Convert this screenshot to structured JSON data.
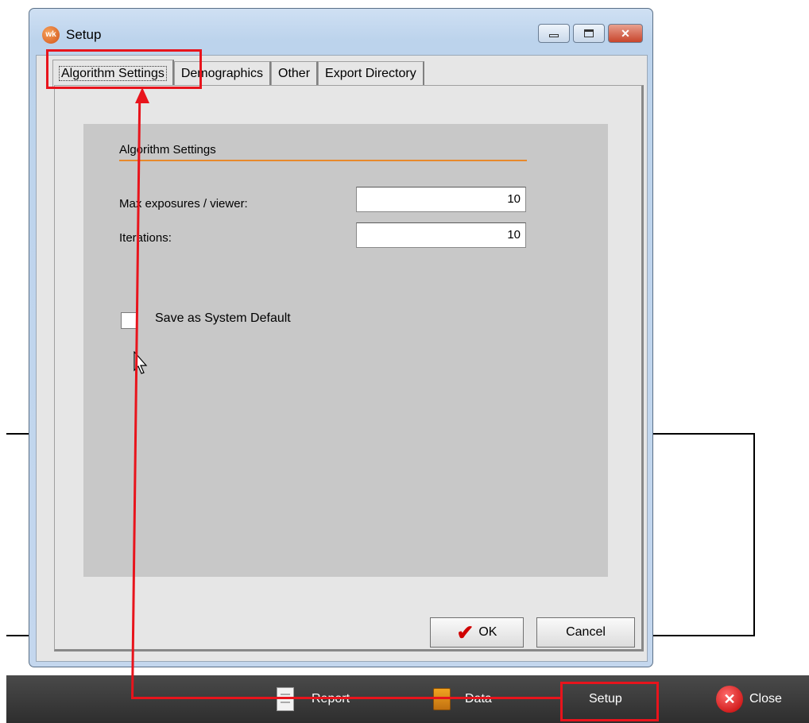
{
  "dialog": {
    "title": "Setup",
    "icon_text": "wk",
    "tabs": [
      {
        "label": "Algorithm Settings",
        "active": true
      },
      {
        "label": "Demographics",
        "active": false
      },
      {
        "label": "Other",
        "active": false
      },
      {
        "label": "Export Directory",
        "active": false
      }
    ],
    "section_title": "Algorithm Settings",
    "fields": [
      {
        "label": "Max exposures / viewer:",
        "value": "10"
      },
      {
        "label": "Iterations:",
        "value": "10"
      }
    ],
    "checkbox": {
      "label": "Save as System Default",
      "checked": false
    },
    "buttons": {
      "ok": "OK",
      "cancel": "Cancel"
    }
  },
  "toolbar": {
    "report": "Report",
    "data": "Data",
    "setup": "Setup",
    "close": "Close"
  },
  "colors": {
    "annotation": "#e8141c",
    "section_rule": "#e8892b",
    "toolbar_bg": "#3a3a3a"
  }
}
